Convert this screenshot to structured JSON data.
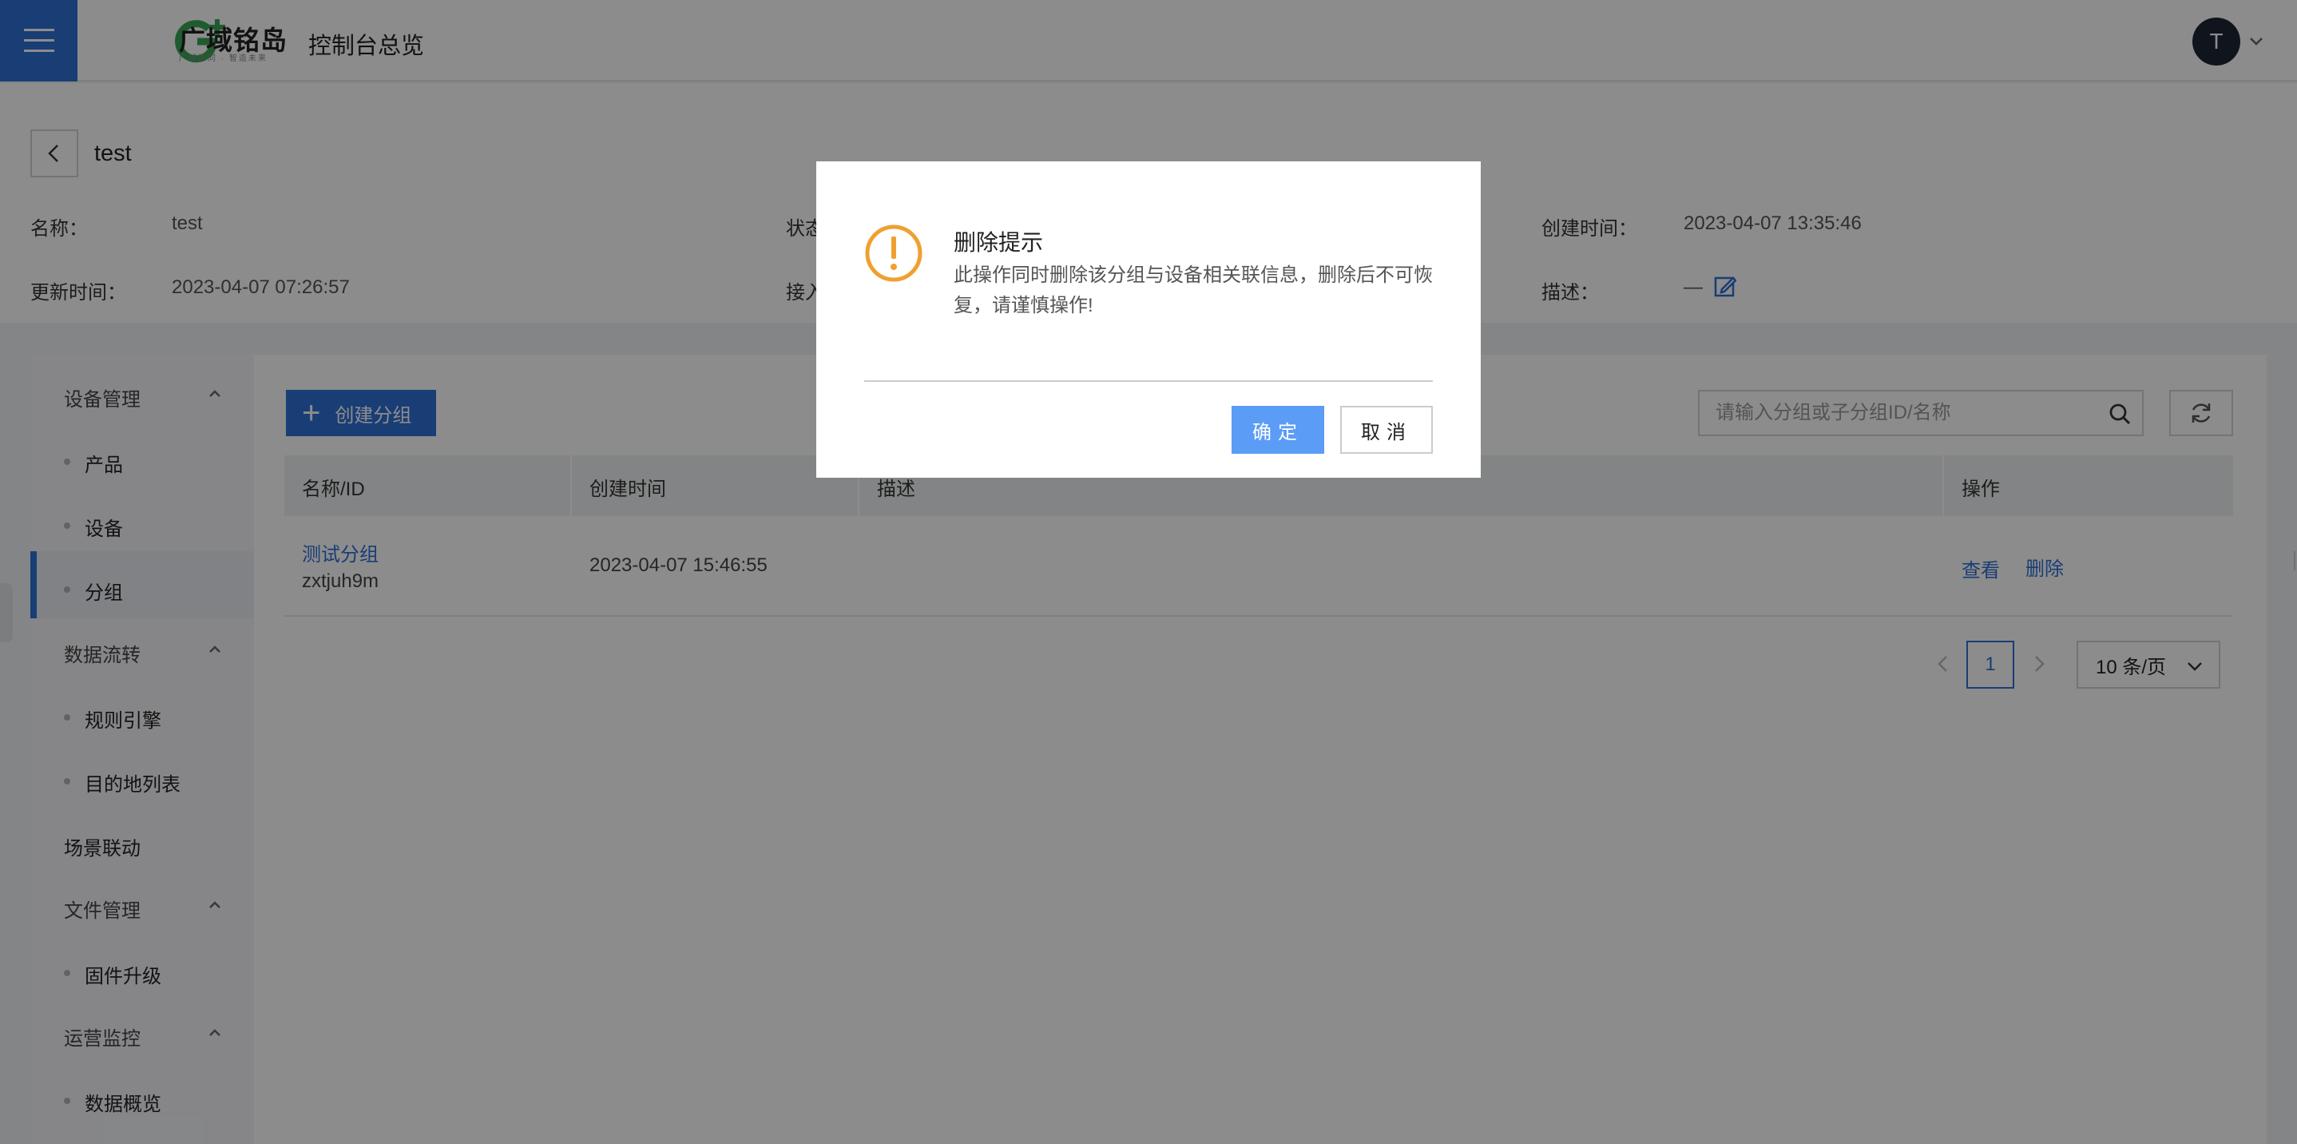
{
  "header": {
    "brand_name": "广域铭岛",
    "brand_tagline": "广域协同 · 智造未来",
    "console_title": "控制台总览",
    "avatar_initial": "T"
  },
  "detail": {
    "title": "test",
    "name_label": "名称：",
    "name_value": "test",
    "status_label": "状态",
    "created_label": "创建时间：",
    "created_value": "2023-04-07 13:35:46",
    "updated_label": "更新时间：",
    "updated_value": "2023-04-07 07:26:57",
    "access_label": "接入",
    "desc_label": "描述：",
    "desc_value": "—"
  },
  "sidebar": {
    "groups": [
      {
        "label": "设备管理",
        "items": [
          "产品",
          "设备",
          "分组"
        ]
      },
      {
        "label": "数据流转",
        "items": [
          "规则引擎",
          "目的地列表"
        ]
      },
      {
        "label": "场景联动",
        "items": []
      },
      {
        "label": "文件管理",
        "items": [
          "固件升级"
        ]
      },
      {
        "label": "运营监控",
        "items": [
          "数据概览"
        ]
      }
    ],
    "active_item": "分组"
  },
  "toolbar": {
    "create_label": "创建分组",
    "search_placeholder": "请输入分组或子分组ID/名称"
  },
  "table": {
    "columns": [
      "名称/ID",
      "创建时间",
      "描述",
      "操作"
    ],
    "rows": [
      {
        "name": "测试分组",
        "id": "zxtjuh9m",
        "created": "2023-04-07 15:46:55",
        "desc": "",
        "actions": [
          "查看",
          "删除"
        ]
      }
    ]
  },
  "pagination": {
    "current_page": "1",
    "page_size": "10 条/页"
  },
  "modal": {
    "title": "删除提示",
    "message": "此操作同时删除该分组与设备相关联信息，删除后不可恢复，请谨慎操作!",
    "confirm_label": "确定",
    "cancel_label": "取消"
  },
  "colors": {
    "primary": "#2f6fd6",
    "warning": "#f0a030",
    "brand_green": "#3aa757"
  }
}
